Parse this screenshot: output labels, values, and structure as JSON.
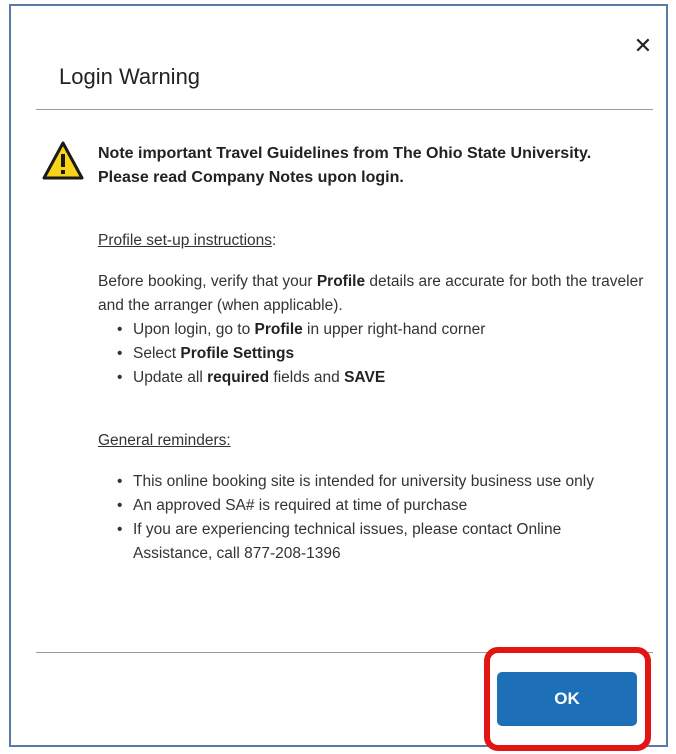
{
  "dialog": {
    "title": "Login Warning",
    "close_glyph": "✕",
    "headline": "Note important Travel Guidelines from The Ohio State University. Please read Company Notes upon login.",
    "profile_section": {
      "heading": "Profile set-up instructions",
      "heading_suffix": ":",
      "intro_a": "Before booking, verify that your ",
      "intro_b": "Profile",
      "intro_c": " details are accurate for both the traveler and the arranger (when applicable).",
      "bullet1_a": "Upon login, go to ",
      "bullet1_b": "Profile",
      "bullet1_c": " in upper right-hand corner",
      "bullet2_a": "Select ",
      "bullet2_b": "Profile Settings",
      "bullet3_a": "Update all ",
      "bullet3_b": "required",
      "bullet3_c": " fields and ",
      "bullet3_d": "SAVE"
    },
    "reminders_section": {
      "heading": "General reminders:",
      "bullets": [
        "This online booking site is intended for university business use only",
        "An approved SA# is required at time of purchase",
        "If you are experiencing technical issues, please contact Online Assistance, call 877-208-1396"
      ]
    },
    "ok_label": "OK"
  },
  "colors": {
    "button_blue": "#1d6fb8",
    "highlight_red": "#e21414",
    "warning_yellow": "#f7d417"
  },
  "icons": {
    "warning": "warning-icon",
    "close": "close-icon"
  }
}
